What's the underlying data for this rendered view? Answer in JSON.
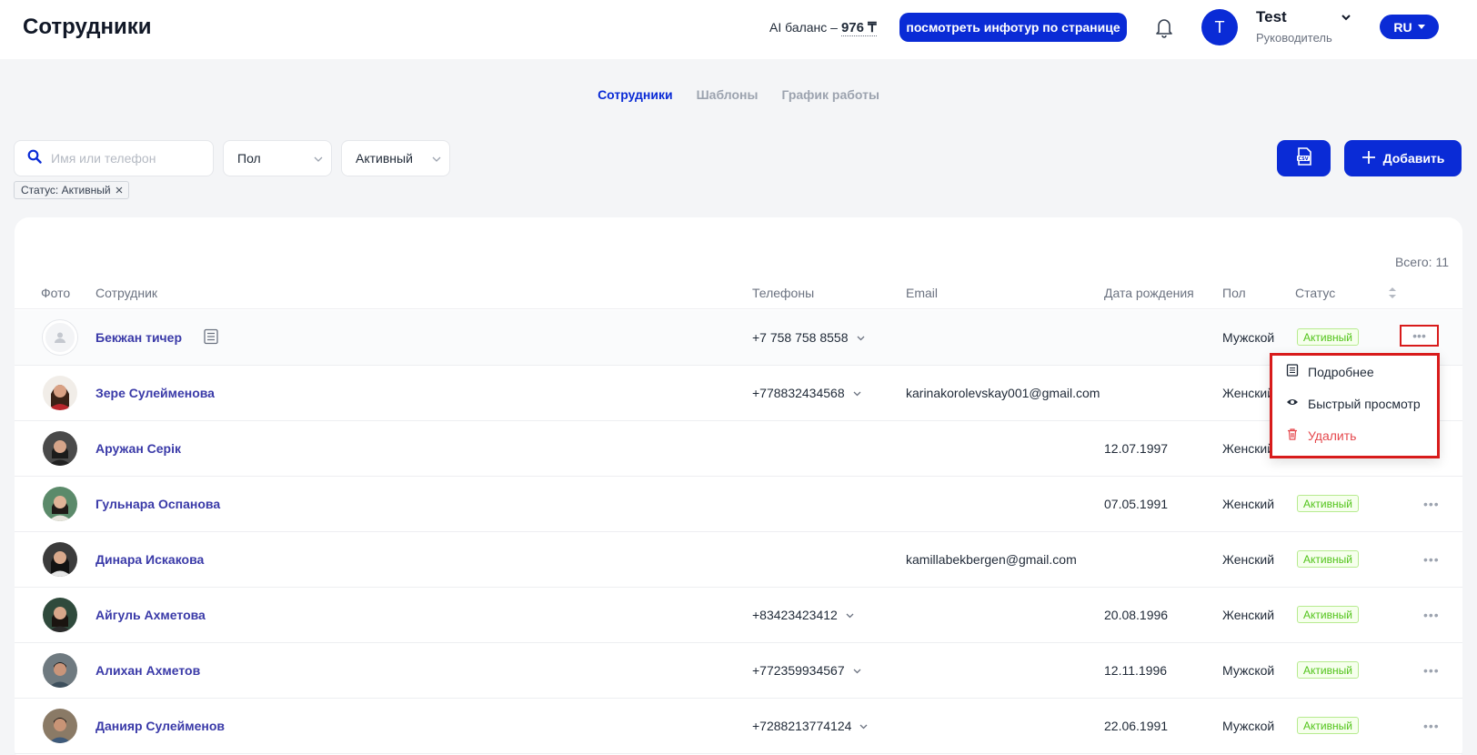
{
  "header": {
    "title": "Сотрудники",
    "ai_balance_label": "AI баланс –",
    "ai_balance_value": "976 ₸",
    "infotour_button": "посмотреть инфотур по странице",
    "user": {
      "initial": "T",
      "name": "Test",
      "role": "Руководитель"
    },
    "language": "RU"
  },
  "tabs": [
    {
      "label": "Сотрудники",
      "active": true
    },
    {
      "label": "Шаблоны",
      "active": false
    },
    {
      "label": "График работы",
      "active": false
    }
  ],
  "filters": {
    "search_placeholder": "Имя или телефон",
    "gender_select": "Пол",
    "status_select": "Активный",
    "active_tag": "Статус: Активный"
  },
  "actions": {
    "add_label": "Добавить",
    "csv_icon": "csv-file-icon"
  },
  "table": {
    "total": "Всего: 11",
    "columns": [
      "Фото",
      "Сотрудник",
      "Телефоны",
      "Email",
      "Дата рождения",
      "Пол",
      "Статус"
    ],
    "rows": [
      {
        "name": "Бекжан тичер",
        "phone": "+7 758 758 8558",
        "email": "",
        "birth": "",
        "gender": "Мужской",
        "status": "Активный"
      },
      {
        "name": "Зере Сулейменова",
        "phone": "+778832434568",
        "email": "karinakorolevskay001@gmail.com",
        "birth": "",
        "gender": "Женский",
        "status": ""
      },
      {
        "name": "Аружан Серік",
        "phone": "",
        "email": "",
        "birth": "12.07.1997",
        "gender": "Женский",
        "status": ""
      },
      {
        "name": "Гульнара Оспанова",
        "phone": "",
        "email": "",
        "birth": "07.05.1991",
        "gender": "Женский",
        "status": "Активный"
      },
      {
        "name": "Динара Искакова",
        "phone": "",
        "email": "kamillabekbergen@gmail.com",
        "birth": "",
        "gender": "Женский",
        "status": "Активный"
      },
      {
        "name": "Айгуль Ахметова",
        "phone": "+83423423412",
        "email": "",
        "birth": "20.08.1996",
        "gender": "Женский",
        "status": "Активный"
      },
      {
        "name": "Алихан Ахметов",
        "phone": "+772359934567",
        "email": "",
        "birth": "12.11.1996",
        "gender": "Мужской",
        "status": "Активный"
      },
      {
        "name": "Данияр Сулейменов",
        "phone": "+7288213774124",
        "email": "",
        "birth": "22.06.1991",
        "gender": "Мужской",
        "status": "Активный"
      }
    ]
  },
  "row_menu": {
    "details": "Подробнее",
    "quick_view": "Быстрый просмотр",
    "delete": "Удалить"
  },
  "colors": {
    "primary": "#0a2bd6",
    "name_link": "#3a3aa8",
    "active_badge": "#52c41a",
    "danger": "#e5484d",
    "highlight_box": "#d81b1b"
  }
}
